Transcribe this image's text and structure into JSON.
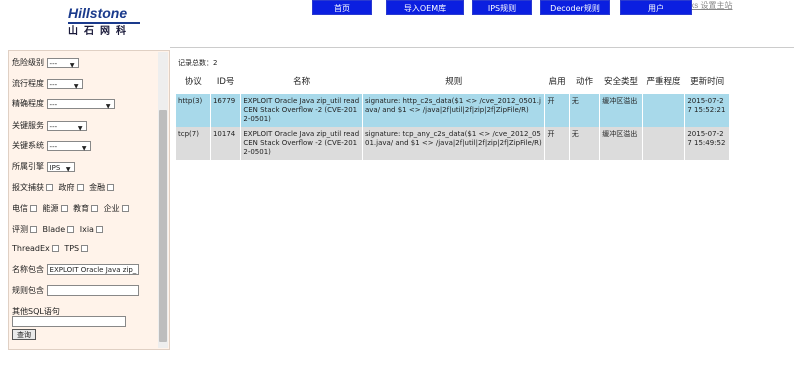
{
  "logo": {
    "brand": "Hillstone",
    "chinese": "山石网科"
  },
  "topbar": {
    "lang_label": "简体",
    "links": "Hillstone Networks 设置主站"
  },
  "nav": [
    "首页",
    "导入OEM库",
    "IPS规则",
    "Decoder规则",
    "用户"
  ],
  "filters": {
    "danger_level": {
      "label": "危险级别",
      "value": "---"
    },
    "popularity": {
      "label": "流行程度",
      "value": "---"
    },
    "accuracy": {
      "label": "精确程度",
      "value": "---"
    },
    "service": {
      "label": "关键服务",
      "value": "---"
    },
    "system": {
      "label": "关键系统",
      "value": "---"
    },
    "engine": {
      "label": "所属引擎",
      "value": "IPS"
    },
    "category_label": "报文捕获",
    "checkbox_rows": [
      [
        "政府",
        "金融"
      ],
      [
        "电信",
        "能源",
        "教育",
        "企业"
      ],
      [
        "评测",
        "Blade",
        "Ixia"
      ],
      [
        "ThreadEx",
        "TPS"
      ]
    ],
    "name_contains": {
      "label": "名称包含",
      "value": "EXPLOIT Oracle Java zip_"
    },
    "rule_contains": {
      "label": "规则包含",
      "value": ""
    },
    "sql": {
      "label": "其他SQL语句",
      "value": ""
    },
    "query_button": "查询"
  },
  "results": {
    "count_label": "记录总数：2",
    "headers": [
      "协议",
      "ID号",
      "名称",
      "规则",
      "启用",
      "动作",
      "安全类型",
      "严重程度",
      "更新时间"
    ],
    "rows": [
      {
        "protocol": "http(3)",
        "id": "16779",
        "name": "EXPLOIT Oracle Java zip_util readCEN Stack Overflow -2 (CVE-2012-0501)",
        "rule": "signature: http_c2s_data($1 <> /cve_2012_0501.java/ and $1 <> /java|2f|util|2f|zip|2f|ZipFile/R)",
        "enabled": "开",
        "action": "无",
        "type": "缓冲区溢出",
        "severity": "",
        "updated": "2015-07-27 15:52:21"
      },
      {
        "protocol": "tcp(7)",
        "id": "10174",
        "name": "EXPLOIT Oracle Java zip_util readCEN Stack Overflow -2 (CVE-2012-0501)",
        "rule": "signature: tcp_any_c2s_data($1 <> /cve_2012_0501.java/ and $1 <> /java|2f|util|2f|zip|2f|ZipFile/R)",
        "enabled": "开",
        "action": "无",
        "type": "缓冲区溢出",
        "severity": "",
        "updated": "2015-07-27 15:49:52"
      }
    ]
  }
}
